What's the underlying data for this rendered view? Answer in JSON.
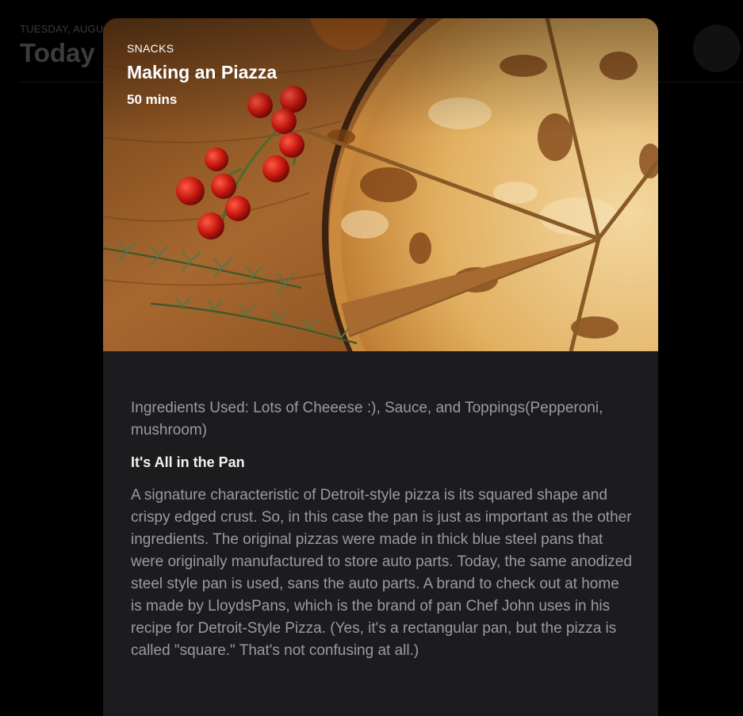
{
  "background": {
    "date_label": "TUESDAY, AUGU",
    "title": "Today"
  },
  "card": {
    "category": "SNACKS",
    "title": "Making an Piazza",
    "duration": "50 mins",
    "ingredients": "Ingredients Used: Lots of Cheeese :), Sauce, and Toppings(Pepperoni, mushroom)",
    "section_heading": "It's All in the Pan",
    "paragraph": "A signature characteristic of Detroit-style pizza is its squared shape and crispy edged crust. So, in this case the pan is just as important as the other ingredients. The original pizzas were made in thick blue steel pans that were originally manufactured to store auto parts. Today, the same anodized steel style pan is used, sans the auto parts. A brand to check out at home is made by LloydsPans, which is the brand of pan Chef John uses in his recipe for Detroit-Style Pizza. (Yes, it's a rectangular pan, but the pizza is called \"square.\" That's not confusing at all.)"
  },
  "colors": {
    "page_bg": "#000000",
    "card_bg": "#1c1c1e",
    "body_text": "#9b9b9f",
    "heading_text": "#f2f2f2",
    "wood": "#9a5f2a",
    "cheese": "#e8b866",
    "tomato": "#b3140f"
  },
  "hero_image": {
    "subject": "pizza-on-wooden-board-with-cherry-tomatoes-and-rosemary"
  }
}
